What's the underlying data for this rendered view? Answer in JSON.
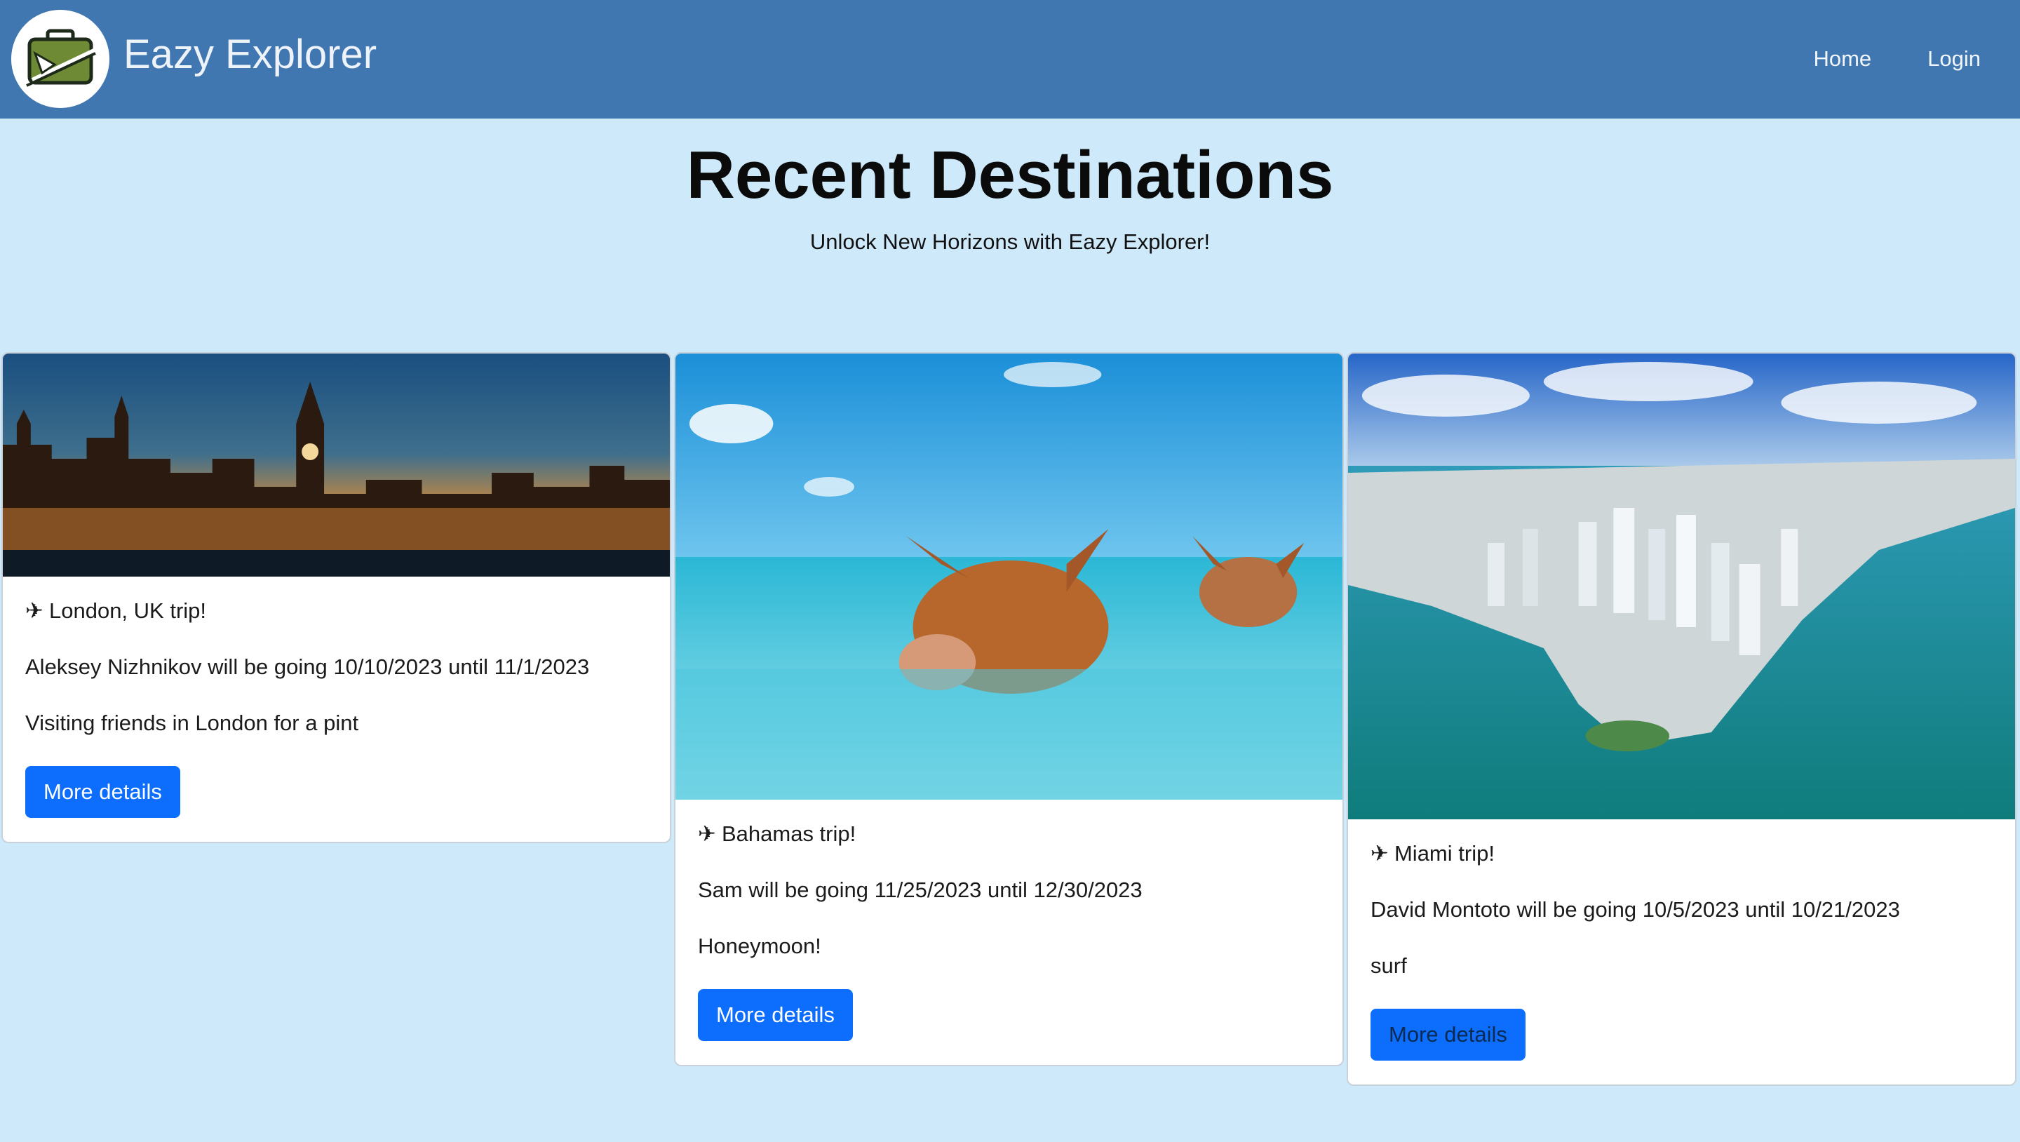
{
  "navbar": {
    "brand": "Eazy Explorer",
    "links": [
      "Home",
      "Login"
    ]
  },
  "hero": {
    "title": "Recent Destinations",
    "subtitle": "Unlock New Horizons with Eazy Explorer!"
  },
  "cards": [
    {
      "title": "London, UK trip!",
      "traveler_line": "Aleksey Nizhnikov will be going 10/10/2023 until 11/1/2023",
      "description": "Visiting friends in London for a pint",
      "button_label": "More details"
    },
    {
      "title": "Bahamas trip!",
      "traveler_line": "Sam will be going 11/25/2023 until 12/30/2023",
      "description": "Honeymoon!",
      "button_label": "More details"
    },
    {
      "title": "Miami trip!",
      "traveler_line": "David Montoto will be going 10/5/2023 until 10/21/2023",
      "description": "surf",
      "button_label": "More details"
    }
  ],
  "icons": {
    "brand_logo": "suitcase-airplane-icon",
    "card_title": "airplane-icon"
  },
  "colors": {
    "navbar_bg": "#4077b0",
    "page_bg": "#cde9fa",
    "button_bg": "#0d6efd"
  }
}
